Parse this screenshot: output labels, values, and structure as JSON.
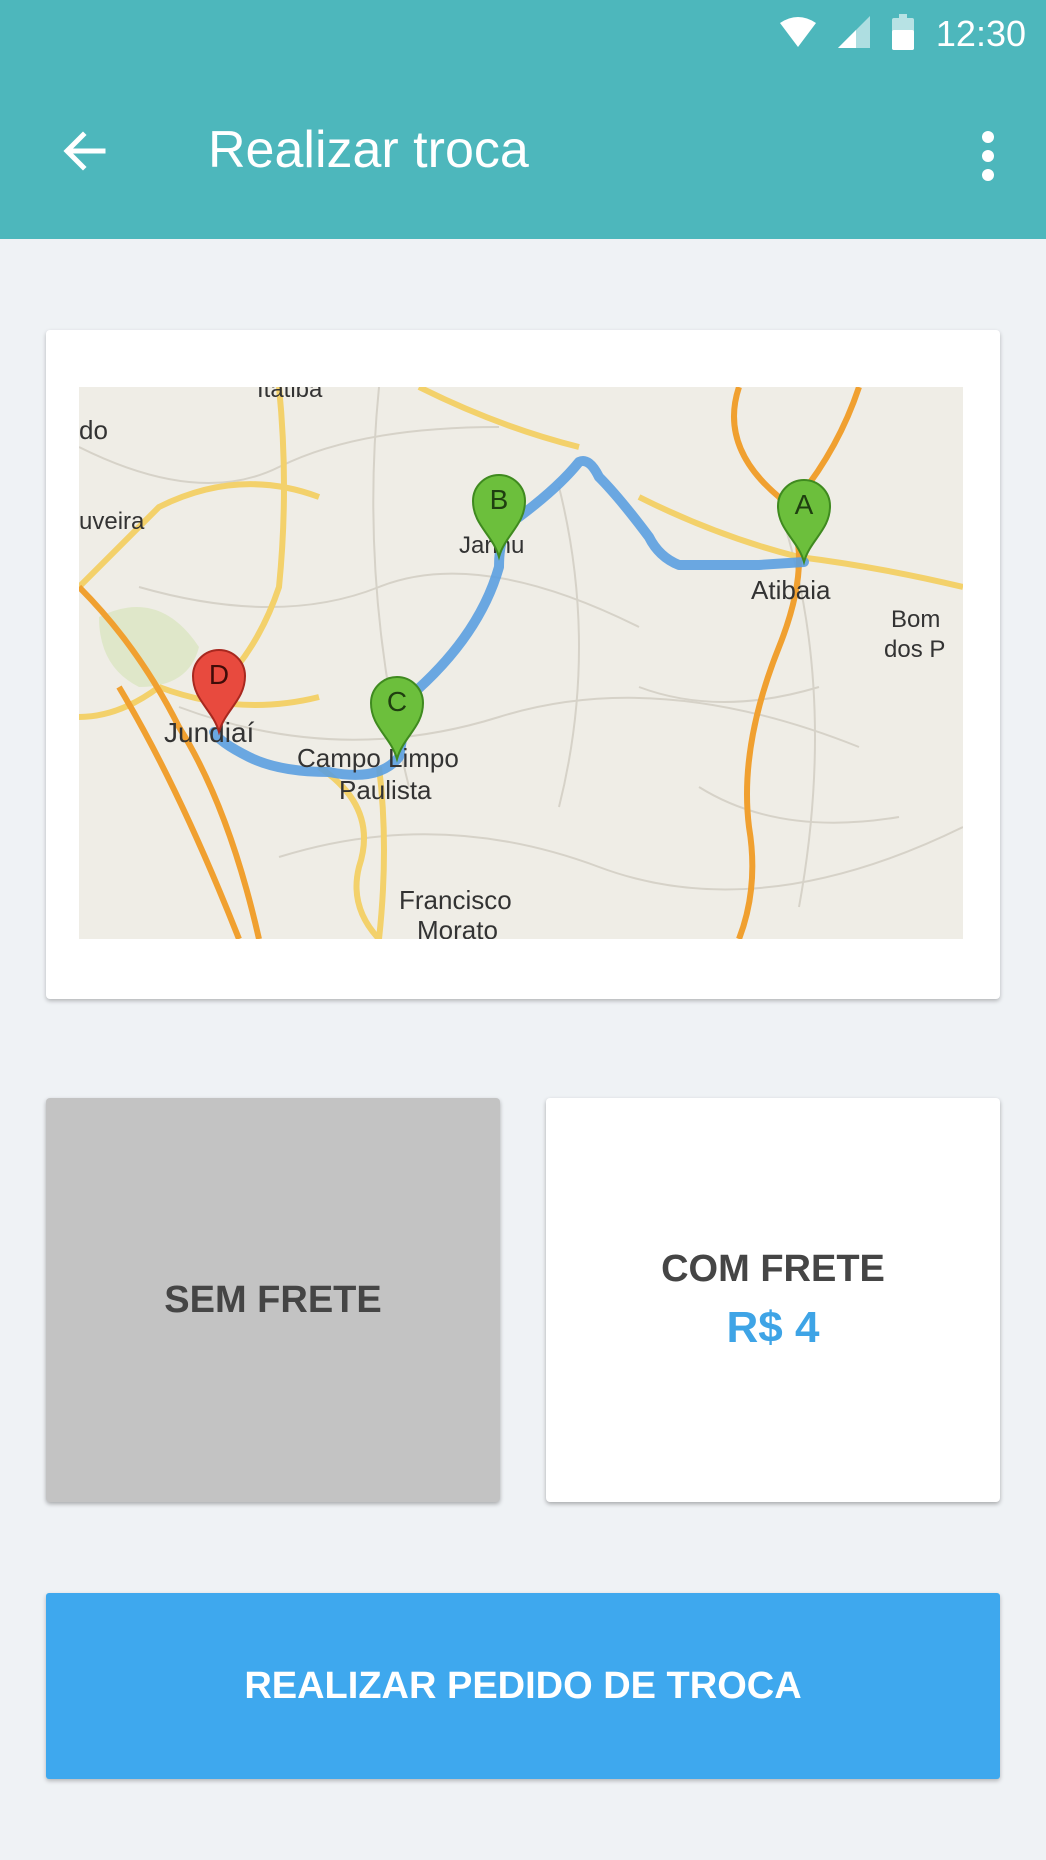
{
  "status_bar": {
    "time": "12:30",
    "icons": [
      "wifi-icon",
      "signal-icon",
      "battery-icon"
    ]
  },
  "app_bar": {
    "title": "Realizar troca",
    "back_icon": "arrow-back-icon",
    "menu_icon": "more-vertical-icon"
  },
  "map": {
    "places": [
      "Itatiba",
      "do",
      "uveira",
      "Jarinu",
      "Atibaia",
      "Bom",
      "dos P",
      "Jundiaí",
      "Campo Limpo",
      "Paulista",
      "Francisco",
      "Morato"
    ],
    "markers": [
      {
        "label": "A",
        "color": "#6cbf3c"
      },
      {
        "label": "B",
        "color": "#6cbf3c"
      },
      {
        "label": "C",
        "color": "#6cbf3c"
      },
      {
        "label": "D",
        "color": "#e84a3e"
      }
    ],
    "route_color": "#5b9fe0"
  },
  "options": {
    "sem_frete": {
      "label": "SEM FRETE"
    },
    "com_frete": {
      "label": "COM FRETE",
      "price": "R$ 4"
    }
  },
  "cta": {
    "label": "REALIZAR PEDIDO DE TROCA"
  },
  "colors": {
    "primary": "#4db7bc",
    "accent": "#3ea8ee",
    "price": "#3ea4e6",
    "background": "#eff2f5"
  }
}
